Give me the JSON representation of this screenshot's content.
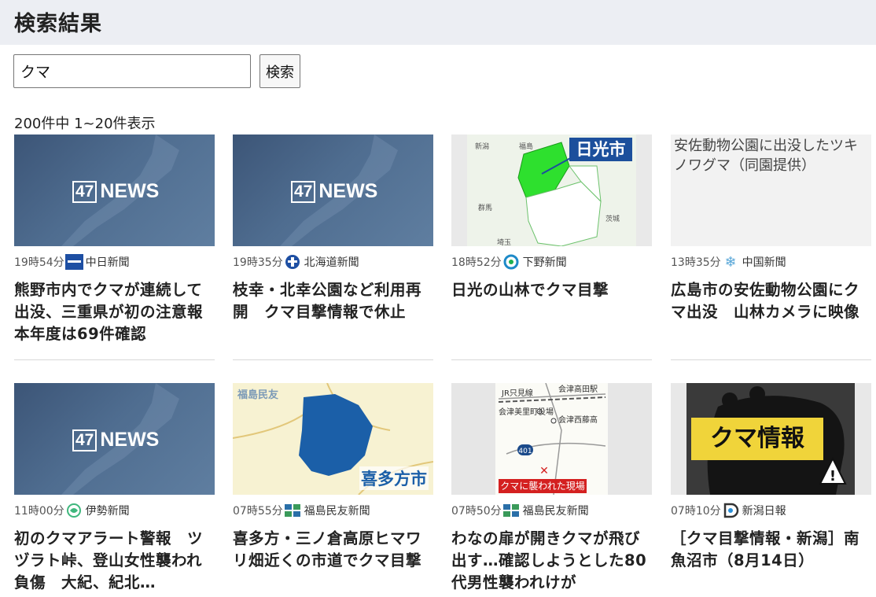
{
  "page": {
    "title": "検索結果"
  },
  "search": {
    "value": "クマ",
    "button_label": "検索"
  },
  "results": {
    "count_text": "200件中 1~20件表示",
    "items": [
      {
        "time": "19時54分",
        "source": "中日新聞",
        "headline": "熊野市内でクマが連続して出没、三重県が初の注意報　本年度は69件確認",
        "thumb_text": "47NEWS"
      },
      {
        "time": "19時35分",
        "source": "北海道新聞",
        "headline": "枝幸・北幸公園など利用再開　クマ目撃情報で休止",
        "thumb_text": "47NEWS"
      },
      {
        "time": "18時52分",
        "source": "下野新聞",
        "headline": "日光の山林でクマ目撃",
        "thumb_text": "日光市"
      },
      {
        "time": "13時35分",
        "source": "中国新聞",
        "headline": "広島市の安佐動物公園にクマ出没　山林カメラに映像",
        "thumb_text": "安佐動物公園に出没したツキノワグマ（同園提供）"
      },
      {
        "time": "11時00分",
        "source": "伊勢新聞",
        "headline": "初のクマアラート警報　ツヅラト峠、登山女性襲われ負傷　大紀、紀北…",
        "thumb_text": "47NEWS"
      },
      {
        "time": "07時55分",
        "source": "福島民友新聞",
        "headline": "喜多方・三ノ倉高原ヒマワリ畑近くの市道でクマ目撃",
        "thumb_text": "喜多方市"
      },
      {
        "time": "07時50分",
        "source": "福島民友新聞",
        "headline": "わなの扉が開きクマが飛び出す…確認しようとした80代男性襲われけが",
        "thumb_text": "クマに襲われた現場"
      },
      {
        "time": "07時10分",
        "source": "新潟日報",
        "headline": "［クマ目撃情報・新潟］南魚沼市（8月14日）",
        "thumb_text": "クマ情報"
      }
    ]
  },
  "thumb_labels": {
    "news_box": "47",
    "news_word": "NEWS",
    "map_fukushima_brand": "福島民友",
    "map_labels_nikko": [
      "新潟",
      "福島",
      "群馬",
      "茨城",
      "埼玉"
    ],
    "map_labels_tadami": [
      "JR只見線",
      "会津高田駅",
      "会津美里町役場",
      "会津西藤高",
      "401"
    ]
  },
  "colors": {
    "header_bg": "#eceef3",
    "news47_bg": "#4f6d90",
    "nikko_green": "#2ee02e",
    "kitakata_blue": "#1b5fa8",
    "kuma_yellow": "#f0d43a"
  }
}
